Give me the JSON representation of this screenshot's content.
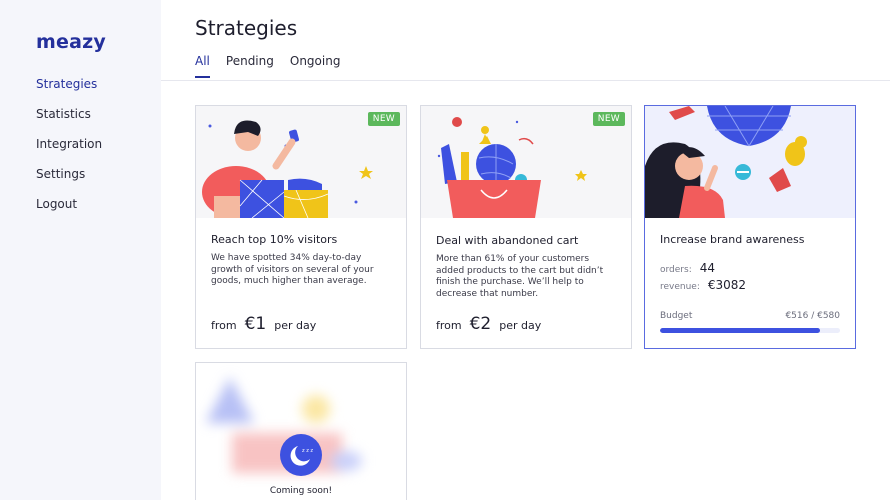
{
  "app": {
    "logo": "meazy"
  },
  "sidebar": {
    "items": [
      {
        "label": "Strategies",
        "active": true
      },
      {
        "label": "Statistics"
      },
      {
        "label": "Integration"
      },
      {
        "label": "Settings"
      },
      {
        "label": "Logout"
      }
    ]
  },
  "main": {
    "title": "Strategies",
    "tabs": [
      {
        "label": "All",
        "active": true
      },
      {
        "label": "Pending"
      },
      {
        "label": "Ongoing"
      }
    ]
  },
  "cards": [
    {
      "badge": "NEW",
      "title": "Reach top 10% visitors",
      "description": "We have spotted 34% day-to-day growth of visitors on several of your goods, much higher than average.",
      "price_from": "from",
      "price_amount": "€1",
      "price_unit": "per day"
    },
    {
      "badge": "NEW",
      "title": "Deal with abandoned cart",
      "description": "More than 61% of your customers added products to the cart but didn’t finish the purchase. We’ll help to decrease that number.",
      "price_from": "from",
      "price_amount": "€2",
      "price_unit": "per day"
    },
    {
      "title": "Increase brand awareness",
      "orders_label": "orders:",
      "orders_value": "44",
      "revenue_label": "revenue:",
      "revenue_value": "€3082",
      "budget_label": "Budget",
      "budget_value": "€516 / €580",
      "budget_fraction": 0.89
    }
  ],
  "coming_soon": {
    "label": "Coming soon!",
    "icon_text": "z z z"
  },
  "colors": {
    "brand": "#24309c",
    "accent": "#3d51e0",
    "badge": "#5cb85c",
    "sidebar_bg": "#f5f6fb"
  }
}
